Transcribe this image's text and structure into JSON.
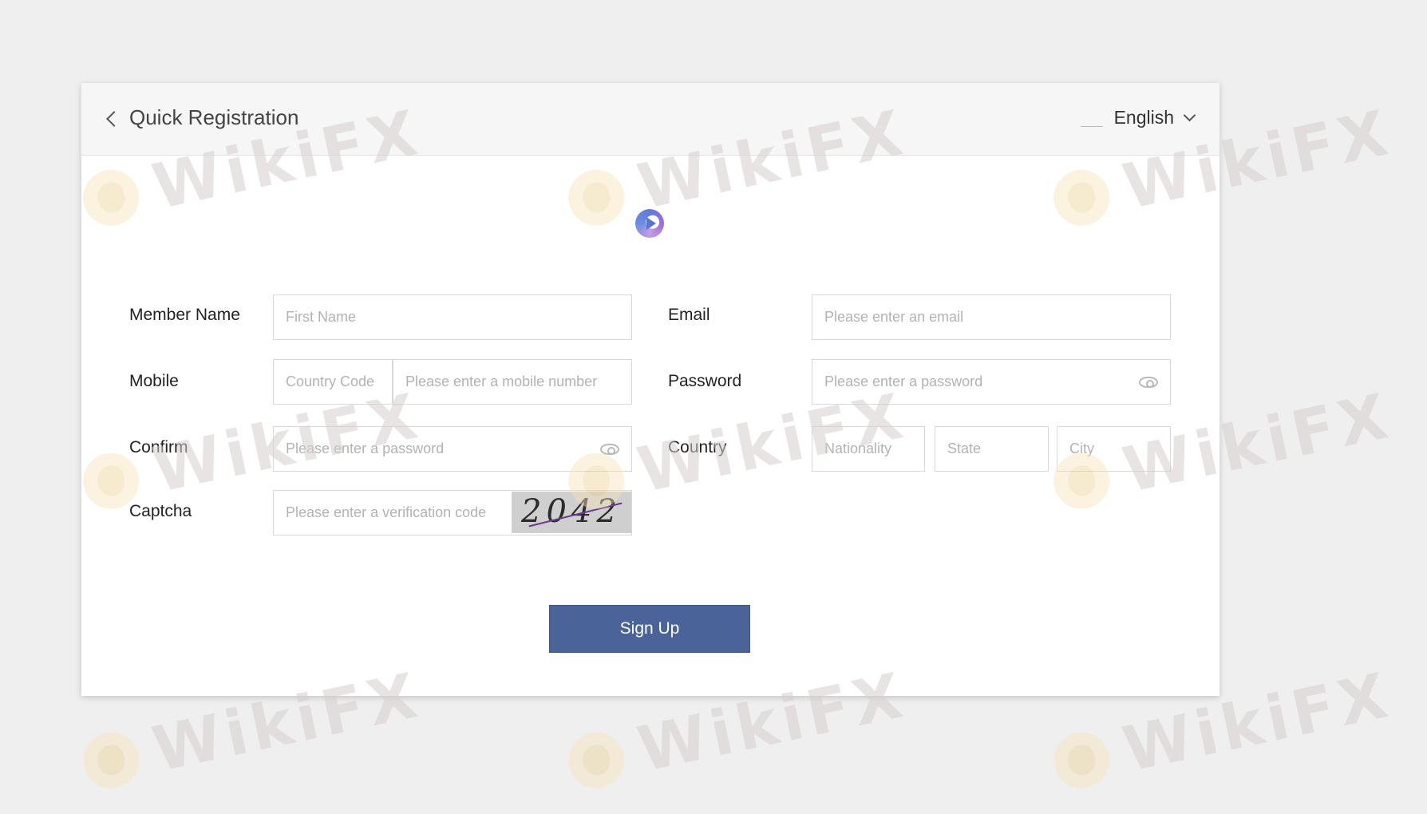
{
  "header": {
    "title": "Quick Registration",
    "language": "English"
  },
  "watermark": {
    "text": "WikiFX"
  },
  "form": {
    "member_name": {
      "label": "Member Name",
      "placeholder": "First Name"
    },
    "email": {
      "label": "Email",
      "placeholder": "Please enter an email"
    },
    "mobile": {
      "label": "Mobile",
      "country_code_placeholder": "Country Code",
      "number_placeholder": "Please enter a mobile number"
    },
    "password": {
      "label": "Password",
      "placeholder": "Please enter a password"
    },
    "confirm": {
      "label": "Confirm",
      "placeholder": "Please enter a password"
    },
    "country": {
      "label": "Country",
      "nationality_placeholder": "Nationality",
      "state_placeholder": "State",
      "city_placeholder": "City"
    },
    "captcha": {
      "label": "Captcha",
      "placeholder": "Please enter a verification code",
      "image_text": "2042"
    },
    "submit_label": "Sign Up"
  },
  "colors": {
    "button": "#4a6399",
    "background": "#efefef"
  }
}
